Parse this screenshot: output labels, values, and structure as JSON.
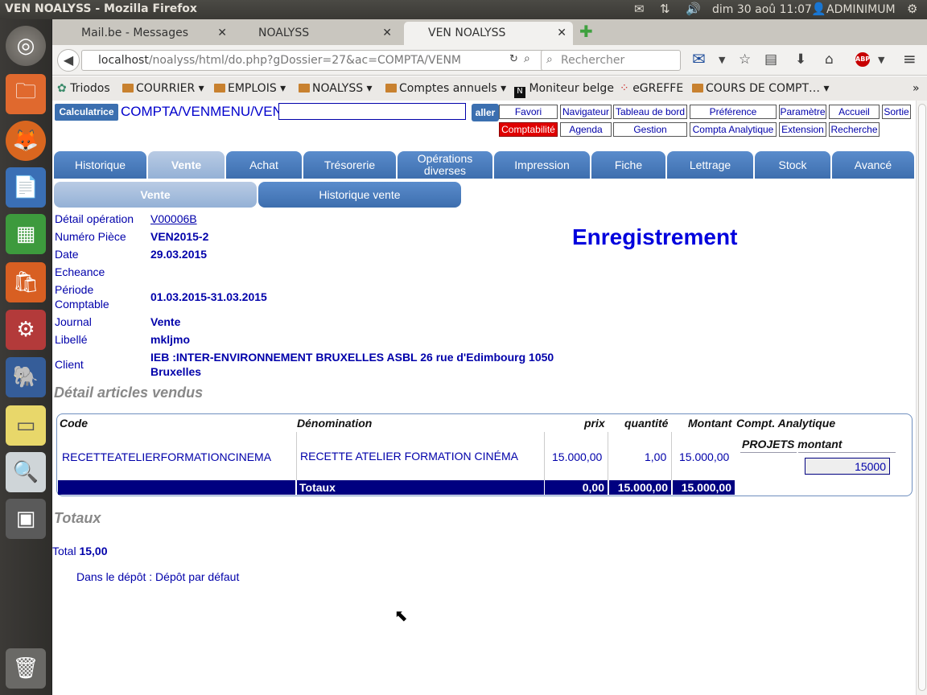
{
  "os": {
    "window_title": "VEN NOALYSS - Mozilla Firefox",
    "clock": "dim 30 aoû 11:07",
    "user": "ADMINIMUM"
  },
  "browser": {
    "tabs": [
      {
        "label": "Mail.be - Messages",
        "active": false
      },
      {
        "label": "NOALYSS",
        "active": false
      },
      {
        "label": "VEN NOALYSS",
        "active": true
      }
    ],
    "url_host": "localhost",
    "url_path": "/noalyss/html/do.php?gDossier=27&ac=COMPTA/VENM",
    "search_placeholder": "Rechercher",
    "bookmarks": [
      "Triodos",
      "COURRIER",
      "EMPLOIS",
      "NOALYSS",
      "Comptes annuels",
      "Moniteur belge",
      "eGREFFE",
      "COURS DE COMPT…"
    ]
  },
  "app": {
    "calc_label": "Calculatrice",
    "path": "COMPTA/VENMENU/VEN",
    "go_label": "aller",
    "top_buttons_row1": [
      "Favori",
      "Navigateur",
      "Tableau de bord",
      "Préférence",
      "Paramètre",
      "Accueil",
      "Sortie"
    ],
    "top_buttons_row2": [
      "Comptabilité",
      "Agenda",
      "Gestion",
      "Compta Analytique",
      "Extension",
      "Recherche"
    ],
    "main_tabs": [
      "Historique",
      "Vente",
      "Achat",
      "Trésorerie",
      "Opérations diverses",
      "Impression",
      "Fiche",
      "Lettrage",
      "Stock",
      "Avancé"
    ],
    "sub_tabs": [
      "Vente",
      "Historique vente"
    ],
    "title": "Enregistrement",
    "details": {
      "op_label": "Détail opération",
      "op_value": "V00006B",
      "piece_label": "Numéro Pièce",
      "piece_value": "VEN2015-2",
      "date_label": "Date",
      "date_value": "29.03.2015",
      "echeance_label": "Echeance",
      "periode_label_1": "Période",
      "periode_label_2": "Comptable",
      "periode_value": "01.03.2015-31.03.2015",
      "journal_label": "Journal",
      "journal_value": "Vente",
      "libelle_label": "Libellé",
      "libelle_value": "mkljmo",
      "client_label": "Client",
      "client_value_1": "IEB :INTER-ENVIRONNEMENT BRUXELLES ASBL 26 rue d'Edimbourg 1050",
      "client_value_2": "Bruxelles"
    },
    "articles_heading": "Détail articles vendus",
    "table": {
      "headers": {
        "code": "Code",
        "denomination": "Dénomination",
        "prix": "prix",
        "quantite": "quantité",
        "montant": "Montant",
        "analytique": "Compt. Analytique"
      },
      "row": {
        "code": "RECETTEATELIERFORMATIONCINEMA",
        "denomination": "RECETTE ATELIER FORMATION CINÉMA",
        "prix": "15.000,00",
        "quantite": "1,00",
        "montant": "15.000,00"
      },
      "analytique_head": "PROJETS montant",
      "analytique_value": "15000",
      "totals": {
        "label": "Totaux",
        "prix": "0,00",
        "quantite": "15.000,00",
        "montant": "15.000,00"
      }
    },
    "totaux_heading": "Totaux",
    "total_label": "Total",
    "total_value": "15,00",
    "depot_text": "Dans le dépôt : Dépôt par défaut"
  },
  "colors": {
    "link_blue": "#0000aa",
    "tab_blue": "#3d6eae",
    "total_bar": "#000080",
    "active_button": "#e00000"
  }
}
